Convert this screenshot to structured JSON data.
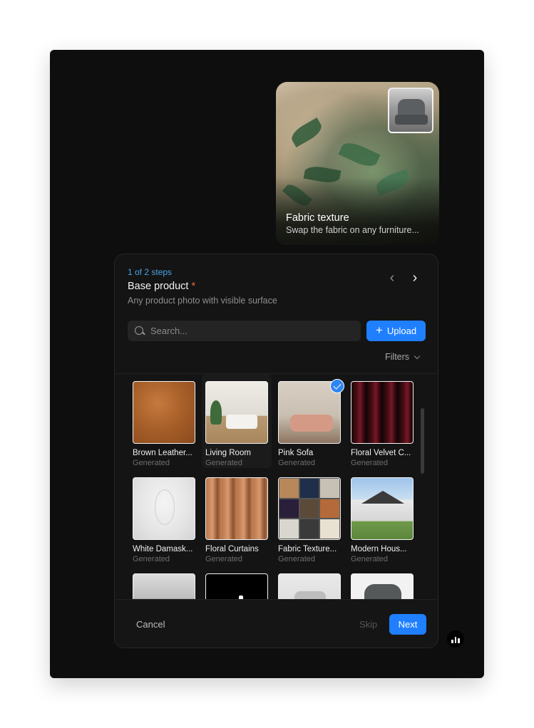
{
  "preview": {
    "title": "Fabric texture",
    "subtitle": "Swap the fabric on any furniture..."
  },
  "dialog": {
    "steps": "1 of 2 steps",
    "title": "Base product",
    "required_mark": "*",
    "subtitle": "Any product photo with visible surface",
    "search": {
      "placeholder": "Search..."
    },
    "upload_label": "Upload",
    "filters_label": "Filters",
    "items": [
      {
        "name": "Brown Leather...",
        "meta": "Generated"
      },
      {
        "name": "Living Room",
        "meta": "Generated"
      },
      {
        "name": "Pink Sofa",
        "meta": "Generated",
        "selected": true
      },
      {
        "name": "Floral Velvet C...",
        "meta": "Generated"
      },
      {
        "name": "White Damask...",
        "meta": "Generated"
      },
      {
        "name": "Floral Curtains",
        "meta": "Generated"
      },
      {
        "name": "Fabric Texture...",
        "meta": "Generated"
      },
      {
        "name": "Modern Hous...",
        "meta": "Generated"
      }
    ],
    "footer": {
      "cancel_label": "Cancel",
      "skip_label": "Skip",
      "next_label": "Next"
    }
  },
  "colors": {
    "accent": "#1f7fff",
    "steps_text": "#4aa3e6",
    "required": "#e46a3a",
    "background": "#0e0e0e"
  },
  "icons": {
    "nav_prev": "chevron-left-icon",
    "nav_next": "chevron-right-icon",
    "search": "search-icon",
    "upload": "plus-icon",
    "filters": "chevron-down-icon",
    "selected": "check-icon",
    "fab": "brand-logo-icon"
  }
}
